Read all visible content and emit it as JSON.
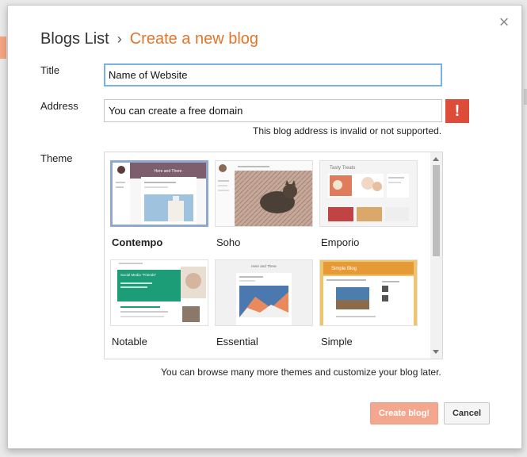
{
  "header": {
    "root": "Blogs List",
    "separator": "›",
    "current": "Create a new blog"
  },
  "form": {
    "title_label": "Title",
    "title_value": "Name of Website",
    "address_label": "Address",
    "address_value": "You can create a free domain",
    "error_icon": "!",
    "error_message": "This blog address is invalid or not supported.",
    "theme_label": "Theme"
  },
  "themes": [
    {
      "name": "Contempo",
      "selected": true
    },
    {
      "name": "Soho",
      "selected": false
    },
    {
      "name": "Emporio",
      "selected": false
    },
    {
      "name": "Notable",
      "selected": false
    },
    {
      "name": "Essential",
      "selected": false
    },
    {
      "name": "Simple",
      "selected": false
    }
  ],
  "thumb_text": {
    "contempo": "Here and There",
    "emporio": "Tasty Treats",
    "notable_banner": "Social Media \"Friends\"",
    "essential": "Here and There",
    "simple": "Simple Blog"
  },
  "footnote": "You can browse many more themes and customize your blog later.",
  "buttons": {
    "create": "Create blog!",
    "cancel": "Cancel"
  },
  "icons": {
    "close": "close-icon",
    "error": "error-icon",
    "chevron": "chevron-right-icon"
  },
  "colors": {
    "accent": "#e4742a",
    "error": "#dd4b39",
    "create_button": "#f4a78f",
    "focus": "#7bb0e6"
  }
}
